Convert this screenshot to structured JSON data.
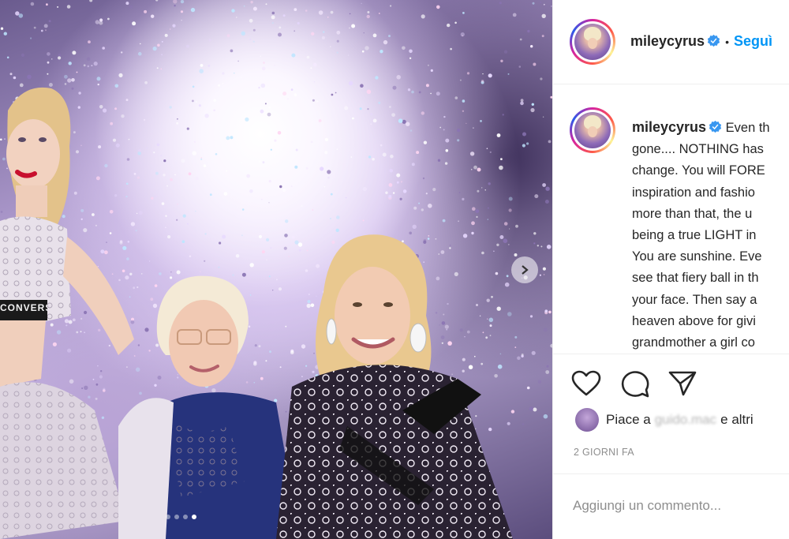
{
  "post": {
    "username": "mileycyrus",
    "follow_label": "Seguì",
    "separator": "•",
    "caption_lines": [
      "Even th",
      "gone.... NOTHING has",
      "change. You will FORE",
      "inspiration and fashio",
      "more than that, the u",
      "being a true LIGHT in",
      "You are sunshine. Eve",
      "see that fiery ball in th",
      "your face. Then say a",
      "heaven above for givi",
      "grandmother a girl co"
    ],
    "likes_prefix": "Piace a",
    "likes_user": "guido.mac",
    "likes_suffix": "e altri",
    "timestamp": "2 GIORNI FA",
    "comment_placeholder": "Aggiungi un commento..."
  },
  "photo": {
    "garment_text": "CONVERS",
    "carousel_dots": 4,
    "active_dot": 4
  },
  "icons": {
    "like": "heart-icon",
    "comment": "comment-icon",
    "share": "send-icon",
    "verified": "verified-badge-icon",
    "next": "chevron-right-icon"
  },
  "colors": {
    "accent": "#0095f6",
    "text": "#262626",
    "muted": "#8e8e8e",
    "border": "#efefef"
  }
}
